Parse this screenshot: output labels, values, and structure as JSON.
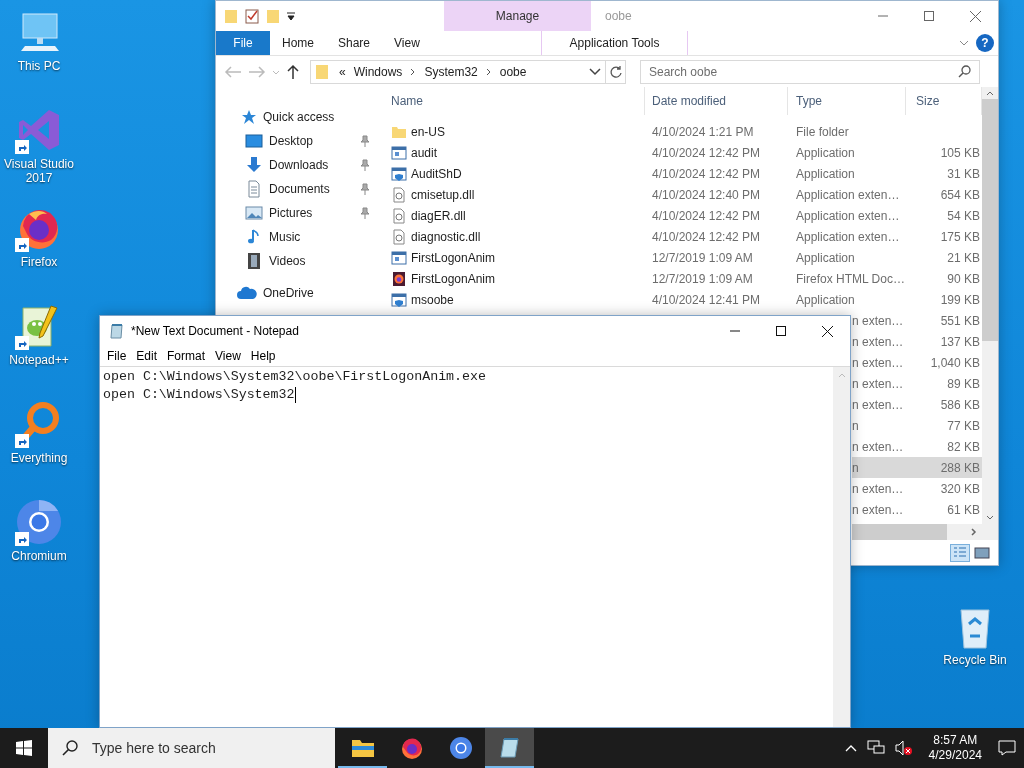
{
  "desktop": {
    "icons": [
      {
        "kind": "pc",
        "label": "This PC",
        "shortcut": false
      },
      {
        "kind": "visual-studio",
        "label": "Visual Studio 2017",
        "shortcut": true
      },
      {
        "kind": "firefox",
        "label": "Firefox",
        "shortcut": true
      },
      {
        "kind": "notepadpp",
        "label": "Notepad++",
        "shortcut": true
      },
      {
        "kind": "everything",
        "label": "Everything",
        "shortcut": true
      },
      {
        "kind": "chromium",
        "label": "Chromium",
        "shortcut": true
      }
    ],
    "recycle_bin": {
      "label": "Recycle Bin"
    }
  },
  "explorer": {
    "title": "oobe",
    "context_tab_group": "Manage",
    "ribbon_tabs": [
      {
        "label": "File",
        "kind": "file"
      },
      {
        "label": "Home",
        "kind": "plain"
      },
      {
        "label": "Share",
        "kind": "plain"
      },
      {
        "label": "View",
        "kind": "plain"
      },
      {
        "label": "Application Tools",
        "kind": "contextual"
      }
    ],
    "help": "?",
    "address": {
      "overflow": "«",
      "segments": [
        "Windows",
        "System32",
        "oobe"
      ]
    },
    "search": {
      "placeholder": "Search oobe"
    },
    "nav": [
      {
        "label": "Quick access",
        "kind": "star",
        "children": [
          {
            "label": "Desktop",
            "kind": "desktop",
            "pinned": true
          },
          {
            "label": "Downloads",
            "kind": "downloads",
            "pinned": true
          },
          {
            "label": "Documents",
            "kind": "documents",
            "pinned": true
          },
          {
            "label": "Pictures",
            "kind": "pictures",
            "pinned": true
          },
          {
            "label": "Music",
            "kind": "music",
            "pinned": false
          },
          {
            "label": "Videos",
            "kind": "videos",
            "pinned": false
          }
        ]
      },
      {
        "label": "OneDrive",
        "kind": "cloud"
      }
    ],
    "columns": [
      "Name",
      "Date modified",
      "Type",
      "Size"
    ],
    "files": [
      {
        "kind": "folder",
        "name": "en-US",
        "date": "4/10/2024 1:21 PM",
        "type": "File folder",
        "selected": false
      },
      {
        "kind": "app",
        "name": "audit",
        "date": "4/10/2024 12:42 PM",
        "type": "Application",
        "size": "105 KB",
        "selected": false
      },
      {
        "kind": "app-shield",
        "name": "AuditShD",
        "date": "4/10/2024 12:42 PM",
        "type": "Application",
        "size": "31 KB",
        "selected": false
      },
      {
        "kind": "dll",
        "name": "cmisetup.dll",
        "date": "4/10/2024 12:40 PM",
        "type": "Application exten…",
        "size": "654 KB",
        "selected": false
      },
      {
        "kind": "dll",
        "name": "diagER.dll",
        "date": "4/10/2024 12:42 PM",
        "type": "Application exten…",
        "size": "54 KB",
        "selected": false
      },
      {
        "kind": "dll",
        "name": "diagnostic.dll",
        "date": "4/10/2024 12:42 PM",
        "type": "Application exten…",
        "size": "175 KB",
        "selected": false
      },
      {
        "kind": "app",
        "name": "FirstLogonAnim",
        "date": "12/7/2019 1:09 AM",
        "type": "Application",
        "size": "21 KB",
        "selected": false
      },
      {
        "kind": "firefox-html",
        "name": "FirstLogonAnim",
        "date": "12/7/2019 1:09 AM",
        "type": "Firefox HTML Doc…",
        "size": "90 KB",
        "selected": false
      },
      {
        "kind": "app-shield",
        "name": "msoobe",
        "date": "4/10/2024 12:41 PM",
        "type": "Application",
        "size": "199 KB",
        "selected": false
      },
      {
        "kind": "hidden",
        "type": "n exten…",
        "size": "551 KB",
        "selected": false
      },
      {
        "kind": "hidden",
        "type": "n exten…",
        "size": "137 KB",
        "selected": false
      },
      {
        "kind": "hidden",
        "type": "n exten…",
        "size": "1,040 KB",
        "selected": false
      },
      {
        "kind": "hidden",
        "type": "n exten…",
        "size": "89 KB",
        "selected": false
      },
      {
        "kind": "hidden",
        "type": "n exten…",
        "size": "586 KB",
        "selected": false
      },
      {
        "kind": "hidden",
        "type": "n",
        "size": "77 KB",
        "selected": false
      },
      {
        "kind": "hidden",
        "type": "n exten…",
        "size": "82 KB",
        "selected": false
      },
      {
        "kind": "hidden",
        "type": "n",
        "size": "288 KB",
        "selected": true
      },
      {
        "kind": "hidden",
        "type": "n exten…",
        "size": "320 KB",
        "selected": false
      },
      {
        "kind": "hidden",
        "type": "n exten…",
        "size": "61 KB",
        "selected": false
      }
    ]
  },
  "notepad": {
    "title": "*New Text Document - Notepad",
    "menu": [
      "File",
      "Edit",
      "Format",
      "View",
      "Help"
    ],
    "lines": [
      "open C:\\Windows\\System32\\oobe\\FirstLogonAnim.exe",
      "open C:\\Windows\\System32"
    ]
  },
  "taskbar": {
    "search_placeholder": "Type here to search",
    "apps": [
      {
        "kind": "explorer",
        "running": true,
        "active": false
      },
      {
        "kind": "firefox",
        "running": false,
        "active": false
      },
      {
        "kind": "chromium",
        "running": false,
        "active": false
      },
      {
        "kind": "notepad",
        "running": true,
        "active": true
      }
    ],
    "time": "8:57 AM",
    "date": "4/29/2024"
  }
}
